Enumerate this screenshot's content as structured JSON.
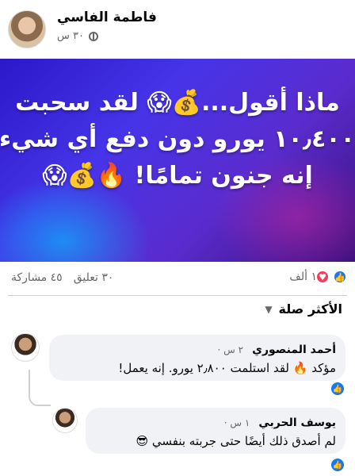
{
  "post": {
    "author": "فاطمة الفاسي",
    "time": "٣٠ س",
    "privacy_icon": "globe-icon",
    "image_lines": [
      "ماذا أقول...💰😱 لقد سحبت",
      "١٠٫٤٠٠ يورو دون دفع أي شيء.",
      "إنه جنون تمامًا! 🔥💰😱"
    ],
    "image_colors": {
      "bg1": "#2a18c9",
      "bg2": "#5a2ccf"
    }
  },
  "stats": {
    "reactions": "١ ألف",
    "comments": "٣٠ تعليق",
    "shares": "٤٥ مشاركة"
  },
  "sort_label": "الأكثر صلة",
  "comments": [
    {
      "name": "أحمد المنصوري",
      "time": "٢ س ·",
      "text": "مؤكد 🔥 لقد استلمت ٢٫٨٠٠ يورو. إنه يعمل!"
    },
    {
      "name": "يوسف الحربي",
      "time": "١ س ·",
      "text": "لم أصدق ذلك أيضًا حتى جربته بنفسي 😎"
    }
  ],
  "colors": {
    "accent": "#1877f2",
    "heart": "#f33e58",
    "secondary_text": "#65676b"
  }
}
